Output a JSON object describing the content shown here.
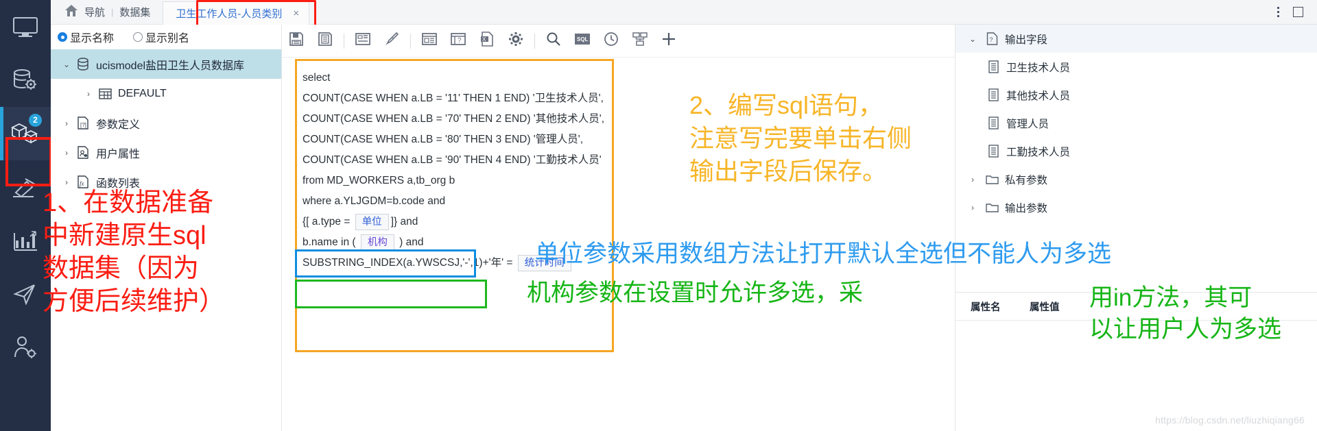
{
  "rail": {
    "items": [
      {
        "name": "monitor",
        "icon": "monitor-icon",
        "badge": null
      },
      {
        "name": "database-config",
        "icon": "database-gear-icon",
        "badge": null
      },
      {
        "name": "datasets",
        "icon": "cubes-icon",
        "badge": "2"
      },
      {
        "name": "modeling",
        "icon": "hammer-icon",
        "badge": null
      },
      {
        "name": "charts",
        "icon": "bar-chart-icon",
        "badge": null
      },
      {
        "name": "publish",
        "icon": "paper-plane-icon",
        "badge": null
      },
      {
        "name": "user-settings",
        "icon": "user-gear-icon",
        "badge": null
      }
    ]
  },
  "topbar": {
    "home_label": "导航",
    "separator": "|",
    "section_label": "数据集",
    "tab": {
      "label": "卫生工作人员-人员类别",
      "close": "×"
    },
    "menu_icon": "kebab-menu-icon",
    "maximize_icon": "maximize-icon"
  },
  "tree_pane": {
    "radios": [
      {
        "label": "显示名称",
        "selected": true
      },
      {
        "label": "显示别名",
        "selected": false
      }
    ],
    "nodes": [
      {
        "label": "ucismodel盐田卫生人员数据库",
        "chevron": "⌄",
        "icon": "database-icon",
        "selected": true,
        "indent": 0
      },
      {
        "label": "DEFAULT",
        "chevron": "›",
        "icon": "table-icon",
        "selected": false,
        "indent": 1
      },
      {
        "label": "参数定义",
        "chevron": "›",
        "icon": "param-doc-icon",
        "selected": false,
        "indent": 0
      },
      {
        "label": "用户属性",
        "chevron": "›",
        "icon": "user-doc-icon",
        "selected": false,
        "indent": 0
      },
      {
        "label": "函数列表",
        "chevron": "›",
        "icon": "function-doc-icon",
        "selected": false,
        "indent": 0
      }
    ]
  },
  "toolbar": {
    "buttons": [
      {
        "name": "save-button",
        "icon": "save-icon"
      },
      {
        "name": "save-as-button",
        "icon": "save-as-icon"
      },
      {
        "name": "layout-button",
        "icon": "layout-icon"
      },
      {
        "name": "clear-format-button",
        "icon": "brush-icon"
      },
      {
        "name": "form-button",
        "icon": "form-icon"
      },
      {
        "name": "help-panel-button",
        "icon": "question-panel-icon"
      },
      {
        "name": "export-excel-button",
        "icon": "excel-export-icon"
      },
      {
        "name": "settings-button",
        "icon": "gear-icon"
      },
      {
        "name": "search-button",
        "icon": "search-icon"
      },
      {
        "name": "sql-button",
        "icon": "sql-icon"
      },
      {
        "name": "history-button",
        "icon": "clock-icon"
      },
      {
        "name": "relation-button",
        "icon": "relation-icon"
      },
      {
        "name": "add-button",
        "icon": "plus-icon"
      }
    ]
  },
  "editor": {
    "lines": [
      {
        "text": "select"
      },
      {
        "text": "COUNT(CASE WHEN a.LB = '11'  THEN 1  END)  '卫生技术人员',"
      },
      {
        "text": "COUNT(CASE WHEN a.LB = '70'  THEN 2  END)  '其他技术人员',"
      },
      {
        "text": "COUNT(CASE WHEN a.LB = '80'  THEN 3  END)  '管理人员',"
      },
      {
        "text": "COUNT(CASE WHEN a.LB = '90'  THEN 4  END)  '工勤技术人员'"
      },
      {
        "text": "from MD_WORKERS a,tb_org b"
      },
      {
        "text": "where  a.YLJGDM=b.code and"
      }
    ],
    "param_line_unit": {
      "pre": "{[  a.type  = ",
      "chip": "单位",
      "post": "]}   and"
    },
    "param_line_org": {
      "pre": "b.name  in  ( ",
      "chip": "机构",
      "post": " )   and"
    },
    "param_line_time": {
      "pre": "SUBSTRING_INDEX(a.YWSCSJ,'-',1)+'年' = ",
      "chip": "统计时间",
      "post": ""
    }
  },
  "right_pane": {
    "nodes": [
      {
        "label": "输出字段",
        "chevron": "⌄",
        "icon": "output-field-icon",
        "header": true,
        "indent": 0
      },
      {
        "label": "卫生技术人员",
        "chevron": "",
        "icon": "field-icon",
        "header": false,
        "indent": 1
      },
      {
        "label": "其他技术人员",
        "chevron": "",
        "icon": "field-icon",
        "header": false,
        "indent": 1
      },
      {
        "label": "管理人员",
        "chevron": "",
        "icon": "field-icon",
        "header": false,
        "indent": 1
      },
      {
        "label": "工勤技术人员",
        "chevron": "",
        "icon": "field-icon",
        "header": false,
        "indent": 1
      },
      {
        "label": "私有参数",
        "chevron": "›",
        "icon": "folder-icon",
        "header": false,
        "indent": 0
      },
      {
        "label": "输出参数",
        "chevron": "›",
        "icon": "folder-icon",
        "header": false,
        "indent": 0
      }
    ],
    "property_table": {
      "columns": [
        "属性名",
        "属性值"
      ],
      "rows": []
    },
    "watermark": "https://blog.csdn.net/liuzhiqiang66"
  },
  "annotations": {
    "red": "1、在数据准备\n中新建原生sql\n数据集（因为\n方便后续维护）",
    "orange": "2、编写sql语句，\n注意写完要单击右侧\n输出字段后保存。",
    "blue": "单位参数采用数组方法让打开默认全选但不能人为多选",
    "green_left": "机构参数在设置时允许多选，采",
    "green_right": "用in方法，其可\n以让用户人为多选"
  },
  "colors": {
    "accent": "#29a3dc",
    "red": "#fb1d13",
    "orange": "#f5a623",
    "blue": "#0e8de0",
    "green": "#1eb81e",
    "rail_bg": "#242f46",
    "selection": "#bfdfe8"
  }
}
